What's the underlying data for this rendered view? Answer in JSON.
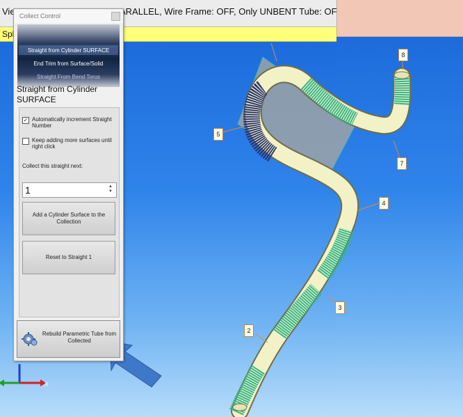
{
  "toolbar": {
    "left_text": "View",
    "status_text": "ARALLEL, Wire Frame: OFF, Only UNBENT Tube: OFF, Tub"
  },
  "yellow_bar": {
    "text": "Spli"
  },
  "panel": {
    "title": "Collect Control",
    "mode_items": [
      "Straight from Cylinder SURFACE",
      "End  Trim from Surface/Solid",
      "Straight From Bend Torus"
    ],
    "heading": "Straight from Cylinder SURFACE",
    "checkbox_auto_increment": {
      "label": "Automatically increment Straight Number",
      "checked": true
    },
    "checkbox_keep_adding": {
      "label": "Keep adding more surfaces until right click",
      "checked": false
    },
    "collect_label": "Collect this straight next:",
    "straight_number": "1",
    "add_button": "Add a Cylinder Surface to the Collection",
    "reset_button": "Reset to Straight 1",
    "rebuild_button": "Rebuild Parametric Tube from Collected"
  },
  "callouts": {
    "c2": "2",
    "c3": "3",
    "c4": "4",
    "c5": "5",
    "c7": "7",
    "c8": "8"
  },
  "axes": {
    "x_label": "X"
  },
  "colors": {
    "viewport_blue": "#1e6ee0",
    "tube_yellow": "#f3f2c6",
    "tube_green": "#35b58a",
    "tube_navy": "#2a3670",
    "toolbar_yellow": "#ffff7a",
    "pink": "#f3c7b6",
    "arrow_blue": "#3f78c8"
  },
  "icons": {
    "gear": "gear-icon",
    "close": "close-icon",
    "arrow": "pointer-arrow-icon"
  }
}
